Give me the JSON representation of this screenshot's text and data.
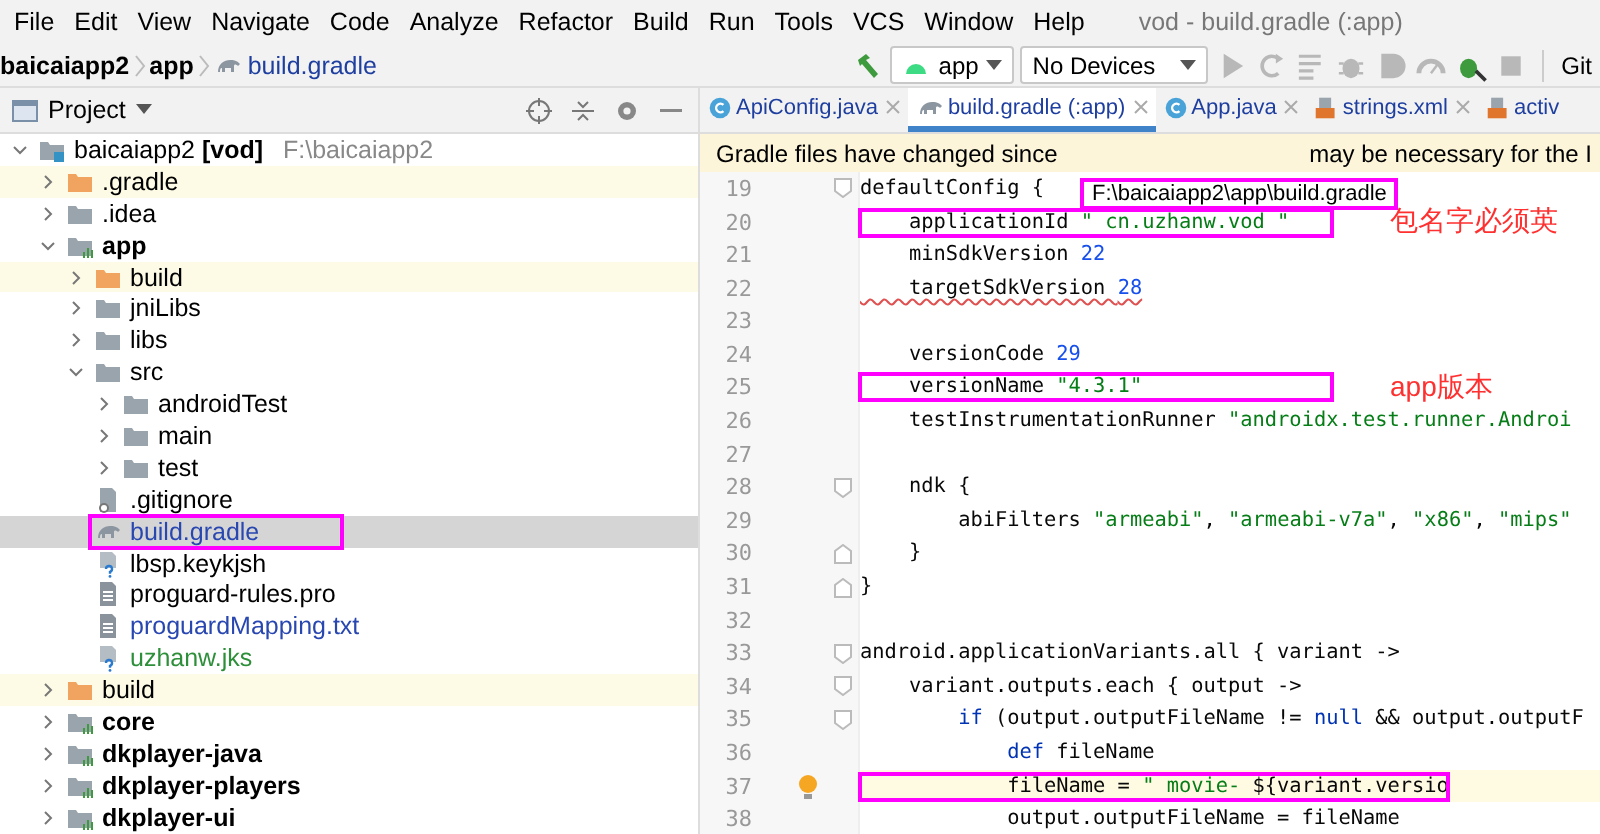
{
  "menu_bar": {
    "items": [
      "File",
      "Edit",
      "View",
      "Navigate",
      "Code",
      "Analyze",
      "Refactor",
      "Build",
      "Run",
      "Tools",
      "VCS",
      "Window",
      "Help"
    ],
    "title": "vod - build.gradle (:app)"
  },
  "breadcrumbs": [
    {
      "label": "baicaiapp2",
      "kind": "folder"
    },
    {
      "label": "app",
      "kind": "folder"
    },
    {
      "label": "build.gradle",
      "kind": "gradle"
    }
  ],
  "toolbar": {
    "run_config": "app",
    "device": "No Devices",
    "buttons": [
      {
        "kind": "run",
        "disabled": true
      },
      {
        "kind": "rerun",
        "disabled": true
      },
      {
        "kind": "list",
        "disabled": true
      },
      {
        "kind": "debug",
        "disabled": true
      },
      {
        "kind": "coverage",
        "disabled": true
      },
      {
        "kind": "profile",
        "disabled": true
      },
      {
        "kind": "attach",
        "disabled": false
      },
      {
        "kind": "stop",
        "disabled": true
      }
    ],
    "vcs_label": "Git"
  },
  "project_panel": {
    "title": "Project"
  },
  "tree": [
    {
      "label": "baicaiapp2 **[vod]**",
      "path": "F:\\baicaiapp2",
      "kind": "project",
      "expanded": true,
      "selected": false,
      "boxed": false,
      "children": [
        {
          "label": ".gradle",
          "kind": "excluded",
          "expanded": false,
          "selected": false,
          "boxed": false
        },
        {
          "label": ".idea",
          "kind": "folder",
          "expanded": false,
          "selected": false,
          "boxed": false
        },
        {
          "label": "app",
          "kind": "module",
          "expanded": true,
          "selected": false,
          "boxed": false,
          "children": [
            {
              "label": "build",
              "kind": "excluded",
              "expanded": false,
              "selected": false,
              "boxed": false
            },
            {
              "label": "jniLibs",
              "kind": "folder",
              "expanded": false,
              "selected": false,
              "boxed": false
            },
            {
              "label": "libs",
              "kind": "folder",
              "expanded": false,
              "selected": false,
              "boxed": false
            },
            {
              "label": "src",
              "kind": "folder",
              "expanded": true,
              "selected": false,
              "boxed": false,
              "children": [
                {
                  "label": "androidTest",
                  "kind": "folder",
                  "expanded": false,
                  "selected": false,
                  "boxed": false
                },
                {
                  "label": "main",
                  "kind": "folder",
                  "expanded": false,
                  "selected": false,
                  "boxed": false
                },
                {
                  "label": "test",
                  "kind": "folder",
                  "expanded": false,
                  "selected": false,
                  "boxed": false
                }
              ]
            },
            {
              "label": ".gitignore",
              "kind": "ignore-file",
              "selected": false,
              "boxed": false
            },
            {
              "label": "build.gradle",
              "kind": "gradle-file",
              "selected": true,
              "boxed": true,
              "color": "#2947b0"
            },
            {
              "label": "lbsp.keykjsh",
              "kind": "unknown-file",
              "selected": false,
              "boxed": false
            },
            {
              "label": "proguard-rules.pro",
              "kind": "text-file",
              "selected": false,
              "boxed": false
            },
            {
              "label": "proguardMapping.txt",
              "kind": "text-file",
              "selected": false,
              "boxed": false,
              "color": "#2947b0"
            },
            {
              "label": "uzhanw.jks",
              "kind": "unknown-file",
              "selected": false,
              "boxed": false,
              "color": "#2e8f3a"
            }
          ]
        },
        {
          "label": "build",
          "kind": "excluded",
          "expanded": false,
          "selected": false,
          "boxed": false
        },
        {
          "label": "core",
          "kind": "module",
          "expanded": false,
          "selected": false,
          "boxed": false
        },
        {
          "label": "dkplayer-java",
          "kind": "module",
          "expanded": false,
          "selected": false,
          "boxed": false
        },
        {
          "label": "dkplayer-players",
          "kind": "module",
          "expanded": false,
          "selected": false,
          "boxed": false
        },
        {
          "label": "dkplayer-ui",
          "kind": "module",
          "expanded": false,
          "selected": false,
          "boxed": false
        }
      ]
    }
  ],
  "tabs": [
    {
      "label": "ApiConfig.java",
      "kind": "java",
      "selected": false,
      "closable": true
    },
    {
      "label": "build.gradle (:app)",
      "kind": "gradle",
      "selected": true,
      "closable": true
    },
    {
      "label": "App.java",
      "kind": "java",
      "selected": false,
      "closable": true
    },
    {
      "label": "strings.xml",
      "kind": "xml",
      "selected": false,
      "closable": true
    },
    {
      "label": "activ",
      "kind": "xml",
      "selected": false,
      "closable": false
    }
  ],
  "notification": {
    "parts": [
      "Gradle files have changed since",
      "may be necessary for the I"
    ]
  },
  "tooltip": "F:\\baicaiapp2\\app\\build.gradle",
  "code": [
    {
      "number": "19",
      "fold_start": true,
      "fold_end": false,
      "boxed": false,
      "current": false,
      "warning": false,
      "tokens": [
        {
          "text": "defaultConfig {",
          "kind": "plain"
        }
      ]
    },
    {
      "number": "20",
      "fold_start": false,
      "fold_end": false,
      "boxed": true,
      "current": false,
      "warning": false,
      "note": "包名字必须英",
      "tokens": [
        {
          "text": "    applicationId ",
          "kind": "plain"
        },
        {
          "text": "\" cn.uzhanw.vod \"",
          "kind": "string"
        }
      ]
    },
    {
      "number": "21",
      "fold_start": false,
      "fold_end": false,
      "boxed": false,
      "current": false,
      "warning": false,
      "tokens": [
        {
          "text": "    minSdkVersion ",
          "kind": "plain"
        },
        {
          "text": "22",
          "kind": "number"
        }
      ]
    },
    {
      "number": "22",
      "fold_start": false,
      "fold_end": false,
      "boxed": false,
      "current": false,
      "warning": true,
      "tokens": [
        {
          "text": "    targetSdkVersion ",
          "kind": "plain"
        },
        {
          "text": "28",
          "kind": "number"
        }
      ]
    },
    {
      "number": "23",
      "fold_start": false,
      "fold_end": false,
      "current": false
    },
    {
      "number": "24",
      "fold_start": false,
      "fold_end": false,
      "boxed": false,
      "current": false,
      "warning": false,
      "tokens": [
        {
          "text": "    versionCode ",
          "kind": "plain"
        },
        {
          "text": "29",
          "kind": "number"
        }
      ]
    },
    {
      "number": "25",
      "fold_start": false,
      "fold_end": false,
      "boxed": true,
      "current": false,
      "warning": false,
      "note": "app版本",
      "tokens": [
        {
          "text": "    versionName ",
          "kind": "plain"
        },
        {
          "text": "\"4.3.1\"",
          "kind": "string"
        }
      ]
    },
    {
      "number": "26",
      "fold_start": false,
      "fold_end": false,
      "boxed": false,
      "current": false,
      "warning": false,
      "tokens": [
        {
          "text": "    testInstrumentationRunner ",
          "kind": "plain"
        },
        {
          "text": "\"androidx.test.runner.Androi",
          "kind": "string"
        }
      ]
    },
    {
      "number": "27",
      "fold_start": false,
      "fold_end": false,
      "current": false
    },
    {
      "number": "28",
      "fold_start": true,
      "fold_end": false,
      "boxed": false,
      "current": false,
      "warning": false,
      "tokens": [
        {
          "text": "    ndk {",
          "kind": "plain"
        }
      ]
    },
    {
      "number": "29",
      "fold_start": false,
      "fold_end": false,
      "boxed": false,
      "current": false,
      "warning": false,
      "tokens": [
        {
          "text": "        abiFilters ",
          "kind": "plain"
        },
        {
          "text": "\"armeabi\"",
          "kind": "string"
        },
        {
          "text": ", ",
          "kind": "plain"
        },
        {
          "text": "\"armeabi-v7a\"",
          "kind": "string"
        },
        {
          "text": ", ",
          "kind": "plain"
        },
        {
          "text": "\"x86\"",
          "kind": "string"
        },
        {
          "text": ", ",
          "kind": "plain"
        },
        {
          "text": "\"mips\"",
          "kind": "string"
        }
      ]
    },
    {
      "number": "30",
      "fold_start": false,
      "fold_end": true,
      "boxed": false,
      "current": false,
      "warning": false,
      "tokens": [
        {
          "text": "    }",
          "kind": "plain"
        }
      ]
    },
    {
      "number": "31",
      "fold_start": false,
      "fold_end": true,
      "boxed": false,
      "current": false,
      "warning": false,
      "tokens": [
        {
          "text": "}",
          "kind": "plain"
        }
      ]
    },
    {
      "number": "32",
      "fold_start": false,
      "fold_end": false,
      "current": false
    },
    {
      "number": "33",
      "fold_start": true,
      "fold_end": false,
      "boxed": false,
      "current": false,
      "warning": false,
      "tokens": [
        {
          "text": "android.applicationVariants.all { variant ->",
          "kind": "plain"
        }
      ]
    },
    {
      "number": "34",
      "fold_start": true,
      "fold_end": false,
      "boxed": false,
      "current": false,
      "warning": false,
      "tokens": [
        {
          "text": "    variant.outputs.each { output ->",
          "kind": "plain"
        }
      ]
    },
    {
      "number": "35",
      "fold_start": true,
      "fold_end": false,
      "boxed": false,
      "current": false,
      "warning": false,
      "tokens": [
        {
          "text": "        if",
          "kind": "keyword"
        },
        {
          "text": " (output.outputFileName != ",
          "kind": "plain"
        },
        {
          "text": "null",
          "kind": "keyword"
        },
        {
          "text": " && output.outputF",
          "kind": "plain"
        }
      ]
    },
    {
      "number": "36",
      "fold_start": false,
      "fold_end": false,
      "boxed": false,
      "current": false,
      "warning": false,
      "tokens": [
        {
          "text": "            def",
          "kind": "keyword"
        },
        {
          "text": " fileName",
          "kind": "plain"
        }
      ]
    },
    {
      "number": "37",
      "fold_start": false,
      "fold_end": false,
      "boxed": true,
      "current": true,
      "warning": false,
      "tokens": [
        {
          "text": "            fileName = ",
          "kind": "plain"
        },
        {
          "text": "\" movie- ",
          "kind": "string"
        },
        {
          "text": "${variant.versio",
          "kind": "plain"
        }
      ]
    },
    {
      "number": "38",
      "fold_start": false,
      "fold_end": false,
      "boxed": false,
      "current": false,
      "warning": false,
      "tokens": [
        {
          "text": "            output.outputFileName = fileName",
          "kind": "plain"
        }
      ]
    }
  ]
}
